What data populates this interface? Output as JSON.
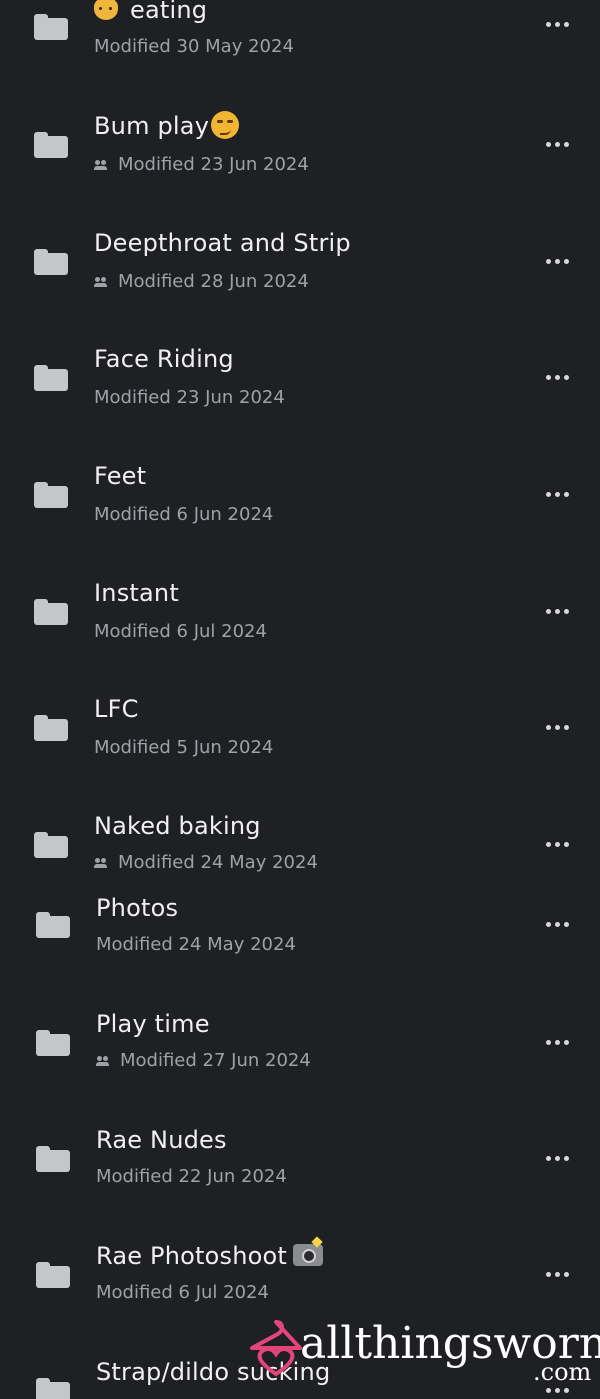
{
  "folders": [
    {
      "title": "eating",
      "modified": "Modified 30 May 2024",
      "shared": false
    },
    {
      "title": "Bum play",
      "modified": "Modified 23 Jun 2024",
      "shared": true
    },
    {
      "title": "Deepthroat and Strip",
      "modified": "Modified 28 Jun 2024",
      "shared": true
    },
    {
      "title": "Face Riding",
      "modified": "Modified 23 Jun 2024",
      "shared": false
    },
    {
      "title": "Feet",
      "modified": "Modified 6 Jun 2024",
      "shared": false
    },
    {
      "title": "Instant",
      "modified": "Modified 6 Jul 2024",
      "shared": false
    },
    {
      "title": "LFC",
      "modified": "Modified 5 Jun 2024",
      "shared": false
    },
    {
      "title": "Naked baking",
      "modified": "Modified 24 May 2024",
      "shared": true
    },
    {
      "title": "Photos",
      "modified": "Modified 24 May 2024",
      "shared": false
    },
    {
      "title": "Play time",
      "modified": "Modified 27 Jun 2024",
      "shared": true
    },
    {
      "title": "Rae Nudes",
      "modified": "Modified 22 Jun 2024",
      "shared": false
    },
    {
      "title": "Rae Photoshoot",
      "modified": "Modified 6 Jul 2024",
      "shared": false
    },
    {
      "title": "Strap/dildo sucking",
      "modified": "",
      "shared": false
    }
  ],
  "icons": {
    "folder": "folder-icon",
    "shared": "shared-people-icon",
    "more": "more-horizontal-icon"
  },
  "colors": {
    "background": "#1f2024",
    "title": "#f0f0f0",
    "subtitle": "#9fa1a6",
    "folder": "#c4c6ca"
  },
  "watermark": {
    "text": "allthingsworn",
    "suffix": ".com"
  }
}
